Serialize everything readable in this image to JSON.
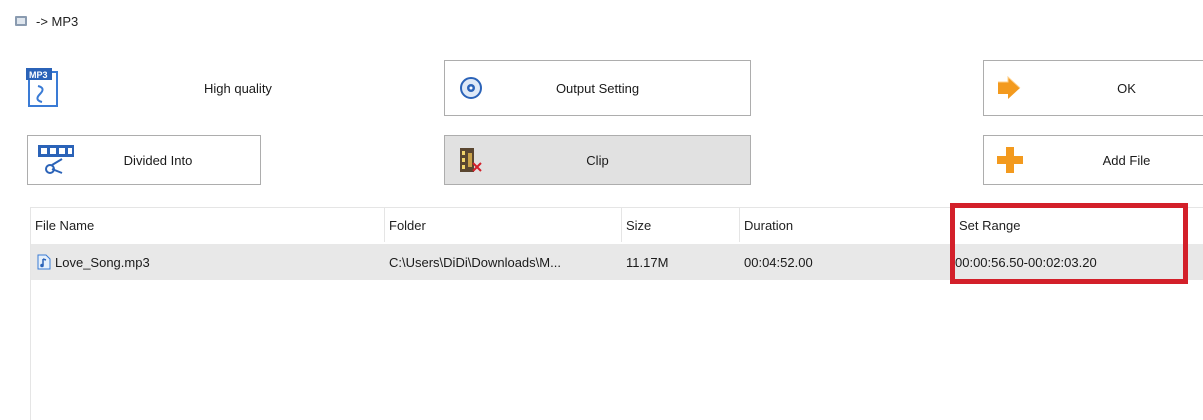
{
  "window": {
    "title": "-> MP3",
    "icon": "app-icon"
  },
  "toolbar": {
    "quality_label": "High quality",
    "quality_icon": "mp3-file-icon",
    "output_setting_label": "Output Setting",
    "output_setting_icon": "settings-disc-icon",
    "ok_label": "OK",
    "ok_icon": "arrow-right-icon",
    "divided_into_label": "Divided Into",
    "divided_into_icon": "split-icon",
    "clip_label": "Clip",
    "clip_icon": "film-clip-icon",
    "add_file_label": "Add File",
    "add_file_icon": "plus-icon"
  },
  "table": {
    "columns": [
      "File Name",
      "Folder",
      "Size",
      "Duration",
      "Set Range"
    ],
    "rows": [
      {
        "file_name": "Love_Song.mp3",
        "folder": "C:\\Users\\DiDi\\Downloads\\M...",
        "size": "11.17M",
        "duration": "00:04:52.00",
        "set_range": "00:00:56.50-00:02:03.20"
      }
    ]
  },
  "colors": {
    "highlight": "#d3202a",
    "selected_row": "#e8e8e8",
    "pressed_button": "#e1e1e1",
    "accent_orange": "#f39a1e"
  }
}
